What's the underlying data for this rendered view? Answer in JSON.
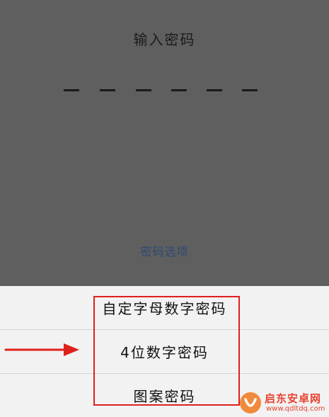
{
  "lock_screen": {
    "title": "输入密码",
    "options_link": "密码选项",
    "code_slots": 6
  },
  "password_type_sheet": {
    "options": [
      {
        "label": "自定字母数字密码"
      },
      {
        "label": "4位数字密码"
      },
      {
        "label": "图案密码"
      }
    ]
  },
  "annotations": {
    "highlight_color": "#e0201c",
    "arrow_color": "#e0201c"
  },
  "watermark": {
    "brand": "启东安卓网",
    "url": "www.qdltdq.com"
  },
  "colors": {
    "dim_overlay": "#5f5f5f",
    "sheet_background": "#f2f2f2",
    "link": "#2c4a73"
  }
}
